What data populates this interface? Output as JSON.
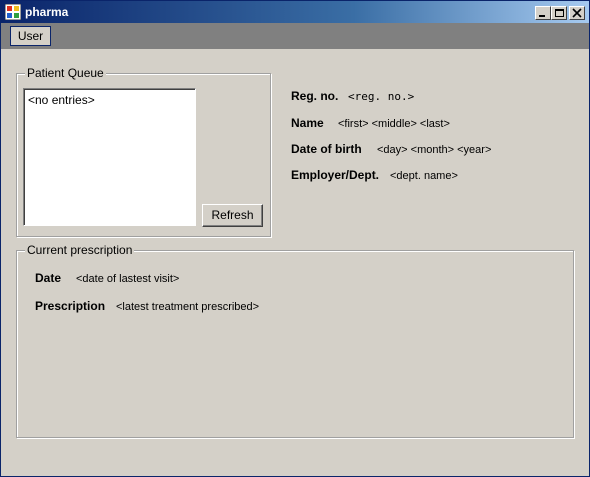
{
  "window": {
    "title": "pharma"
  },
  "menu": {
    "user_label": "User"
  },
  "patient_queue": {
    "group_label": "Patient Queue",
    "list_items": [
      "<no entries>"
    ],
    "refresh_label": "Refresh"
  },
  "patient_info": {
    "reg_no_label": "Reg. no.",
    "reg_no_value": "<reg. no.>",
    "name_label": "Name",
    "name_value": "<first> <middle> <last>",
    "dob_label": "Date of birth",
    "dob_value": "<day> <month> <year>",
    "employer_label": "Employer/Dept.",
    "employer_value": "<dept. name>"
  },
  "current_prescription": {
    "group_label": "Current prescription",
    "date_label": "Date",
    "date_value": "<date of lastest visit>",
    "prescription_label": "Prescription",
    "prescription_value": "<latest treatment prescribed>"
  },
  "icons": {
    "app": "app-icon",
    "minimize": "minimize-icon",
    "maximize": "maximize-icon",
    "close": "close-icon"
  },
  "colors": {
    "titlebar_start": "#0a246a",
    "titlebar_end": "#a6caf0",
    "face": "#d4d0c8",
    "menubar": "#808080"
  }
}
